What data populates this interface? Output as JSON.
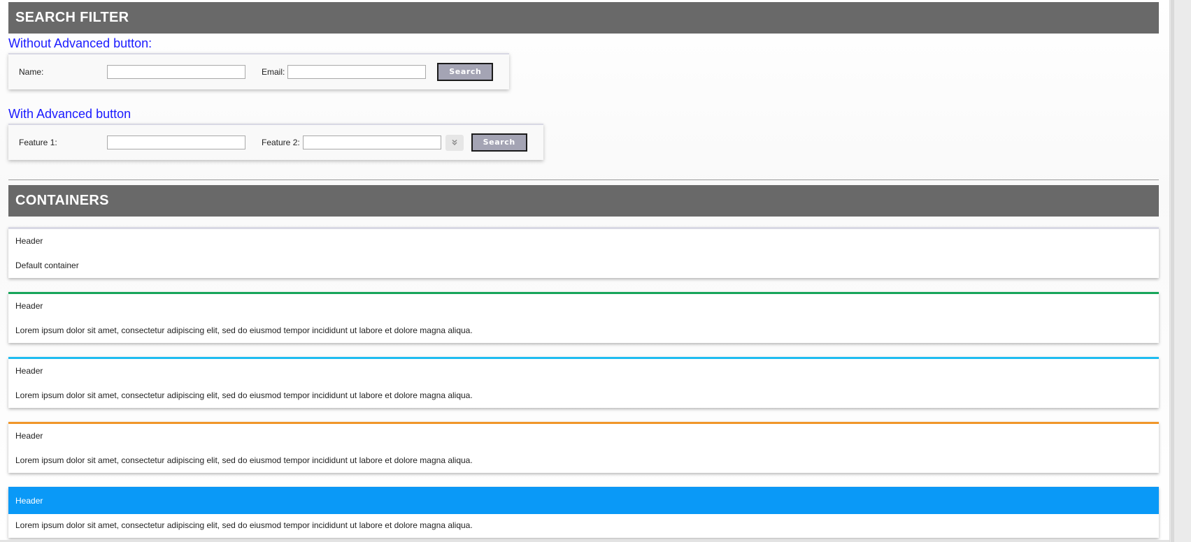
{
  "search_filter": {
    "title": "SEARCH FILTER",
    "without_advanced": {
      "subtitle": "Without Advanced button:",
      "name_label": "Name:",
      "email_label": "Email:",
      "search_label": "Search"
    },
    "with_advanced": {
      "subtitle": "With Advanced button",
      "feature1_label": "Feature 1:",
      "feature2_label": "Feature 2:",
      "search_label": "Search"
    }
  },
  "containers": {
    "title": "CONTAINERS",
    "items": [
      {
        "header": "Header",
        "body": "Default container"
      },
      {
        "header": "Header",
        "body": "Lorem ipsum dolor sit amet, consectetur adipiscing elit, sed do eiusmod tempor incididunt ut labore et dolore magna aliqua."
      },
      {
        "header": "Header",
        "body": "Lorem ipsum dolor sit amet, consectetur adipiscing elit, sed do eiusmod tempor incididunt ut labore et dolore magna aliqua."
      },
      {
        "header": "Header",
        "body": "Lorem ipsum dolor sit amet, consectetur adipiscing elit, sed do eiusmod tempor incididunt ut labore et dolore magna aliqua."
      },
      {
        "header": "Header",
        "body": "Lorem ipsum dolor sit amet, consectetur adipiscing elit, sed do eiusmod tempor incididunt ut labore et dolore magna aliqua."
      }
    ]
  },
  "colors": {
    "section_header_bg": "#696969",
    "subtitle_text": "#1a1aff",
    "container_default_top": "#d8d8e4",
    "container_green_top": "#17a55a",
    "container_cyan_top": "#1ebcf0",
    "container_orange_top": "#f0962a",
    "container_blue_header": "#0a99f7",
    "search_button_bg": "#a4a4b4"
  },
  "icons": {
    "advanced_toggle": "double-chevron-down-icon"
  }
}
